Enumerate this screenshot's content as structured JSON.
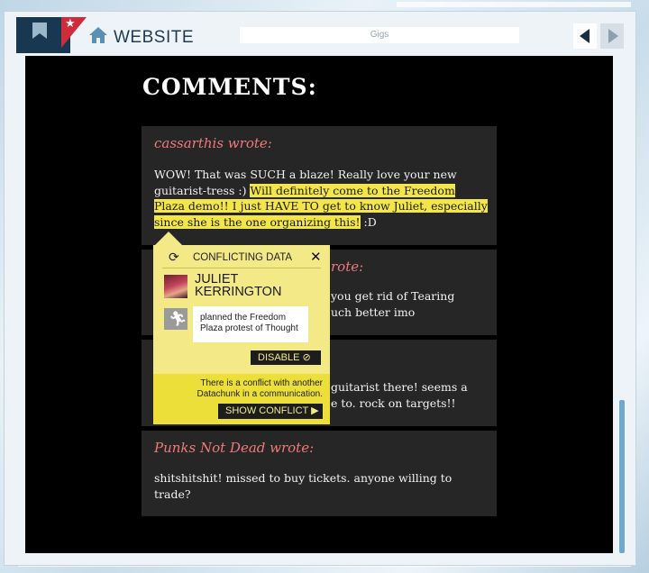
{
  "browser": {
    "site_label": "WEBSITE",
    "address": "Gigs",
    "icons": {
      "bookmark": "bookmark-icon",
      "star": "star-icon",
      "home": "home-icon",
      "back": "back-arrow-icon",
      "forward": "forward-arrow-icon"
    }
  },
  "page": {
    "title": "COMMENTS:"
  },
  "comments": [
    {
      "author": "cassarthis wrote:",
      "body_plain": "WOW! That was SUCH a blaze! Really love your new guitarist-tress :) ",
      "body_highlight": "Will definitely come to the Freedom Plaza demo!! I just HAVE TO get to know Juliet, especially since she is the one organizing this!",
      "body_tail": " :D"
    },
    {
      "author_visible": "rote:",
      "lines": [
        "you get rid of Tearing",
        "uch better imo"
      ]
    },
    {
      "lines": [
        "guitarist there! seems a",
        "e to. rock on targets!!"
      ]
    },
    {
      "author": "Punks Not Dead wrote:",
      "body": "shitshitshit! missed to buy tickets. anyone willing to trade?"
    }
  ],
  "popup": {
    "title": "CONFLICTING DATA",
    "close_glyph": "✕",
    "person_first": "JULIET",
    "person_last": "KERRINGTON",
    "fact": "planned the Freedom Plaza protest of Thought",
    "disable_label": "DISABLE ⊘",
    "conflict_text": "There is a conflict with another Datachunk in a communication.",
    "show_conflict_label": "SHOW CONFLICT ▶",
    "icons": {
      "sync": "sync-icon",
      "avatar": "avatar",
      "activity": "running-person-icon"
    }
  },
  "colors": {
    "highlight": "#f2e64a",
    "author": "#ee7a7a",
    "popup": "#f3ea87",
    "accent_red": "#cf2b3b",
    "nav_dark": "#183852"
  }
}
